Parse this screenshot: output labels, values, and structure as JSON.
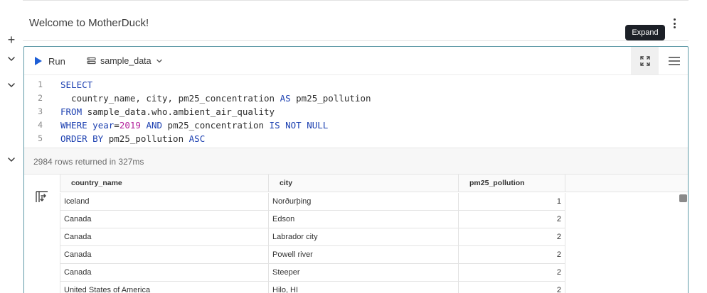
{
  "notebook": {
    "title": "Welcome to MotherDuck!"
  },
  "tooltip": {
    "expand": "Expand"
  },
  "toolbar": {
    "run_label": "Run",
    "database": "sample_data"
  },
  "editor": {
    "lines": [
      {
        "num": "1",
        "tokens": [
          {
            "t": "SELECT",
            "k": "kw"
          }
        ]
      },
      {
        "num": "2",
        "tokens": [
          {
            "t": "  country_name, city, pm25_concentration ",
            "k": "sep"
          },
          {
            "t": "AS",
            "k": "kw"
          },
          {
            "t": " pm25_pollution",
            "k": "sep"
          }
        ]
      },
      {
        "num": "3",
        "tokens": [
          {
            "t": "FROM",
            "k": "kw"
          },
          {
            "t": " sample_data.who.ambient_air_quality",
            "k": "sep"
          }
        ]
      },
      {
        "num": "4",
        "tokens": [
          {
            "t": "WHERE",
            "k": "kw"
          },
          {
            "t": " ",
            "k": "sep"
          },
          {
            "t": "year",
            "k": "kw"
          },
          {
            "t": "=",
            "k": "sep"
          },
          {
            "t": "2019",
            "k": "num"
          },
          {
            "t": " ",
            "k": "sep"
          },
          {
            "t": "AND",
            "k": "kw"
          },
          {
            "t": " pm25_concentration ",
            "k": "sep"
          },
          {
            "t": "IS NOT NULL",
            "k": "kw"
          }
        ]
      },
      {
        "num": "5",
        "tokens": [
          {
            "t": "ORDER BY",
            "k": "kw"
          },
          {
            "t": " pm25_pollution ",
            "k": "sep"
          },
          {
            "t": "ASC",
            "k": "kw"
          }
        ]
      }
    ]
  },
  "results": {
    "summary": "2984 rows returned in 327ms",
    "columns": [
      "country_name",
      "city",
      "pm25_pollution"
    ],
    "rows": [
      [
        "Iceland",
        "Norðurþing",
        "1"
      ],
      [
        "Canada",
        "Edson",
        "2"
      ],
      [
        "Canada",
        "Labrador city",
        "2"
      ],
      [
        "Canada",
        "Powell river",
        "2"
      ],
      [
        "Canada",
        "Steeper",
        "2"
      ],
      [
        "United States of America",
        "Hilo, HI",
        "2"
      ]
    ]
  }
}
